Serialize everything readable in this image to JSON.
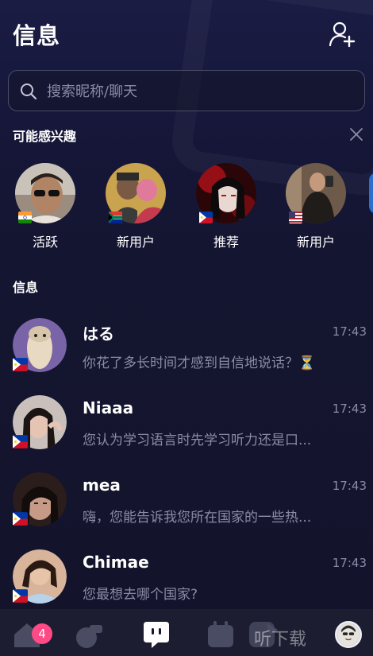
{
  "header": {
    "title": "信息"
  },
  "search": {
    "placeholder": "搜索昵称/聊天"
  },
  "suggestions": {
    "title": "可能感兴趣",
    "items": [
      {
        "label": "活跃",
        "flag": "india"
      },
      {
        "label": "新用户",
        "flag": "south-africa"
      },
      {
        "label": "推荐",
        "flag": "philippines"
      },
      {
        "label": "新用户",
        "flag": "usa"
      }
    ]
  },
  "messages": {
    "title": "信息",
    "items": [
      {
        "name": "はる",
        "time": "17:43",
        "preview": "你花了多长时间才感到自信地说话？⏳",
        "flag": "philippines"
      },
      {
        "name": "Niaaa",
        "time": "17:43",
        "preview": "您认为学习语言时先学习听力还是口...",
        "flag": "philippines"
      },
      {
        "name": "mea",
        "time": "17:43",
        "preview": "嗨，您能告诉我您所在国家的一些热...",
        "flag": "philippines"
      },
      {
        "name": "Chimae",
        "time": "17:43",
        "preview": "您最想去哪个国家?",
        "flag": "philippines"
      }
    ]
  },
  "tabbar": {
    "home_badge": "4",
    "watermark": "听下载",
    "items": [
      "home-icon",
      "whistle-icon",
      "chat-icon",
      "calendar-icon",
      "tools-icon",
      "profile-avatar"
    ]
  },
  "colors": {
    "badge": "#ff4a86",
    "muted": "#8a8ca6",
    "background": "#14162a"
  }
}
